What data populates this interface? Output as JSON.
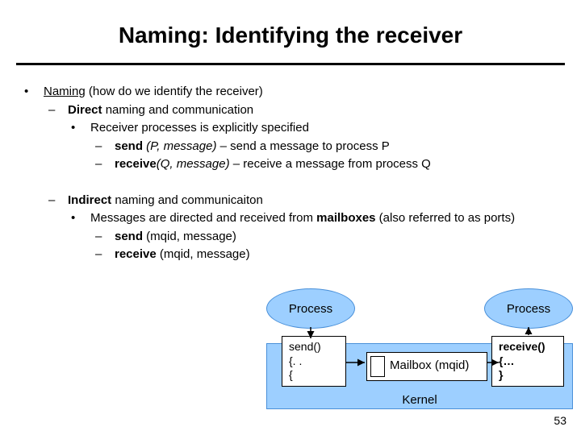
{
  "title": "Naming: Identifying the receiver",
  "l1_bullet": "•",
  "l1_topic": "Naming",
  "l1_rest": "  (how do we identify the receiver)",
  "dash": "–",
  "dot": "•",
  "direct_b": "Direct",
  "direct_rest": " naming and communication",
  "direct_sub": "Receiver processes is explicitly specified",
  "send_b": "send",
  "send_args": " (P, message)",
  "send_rest": " – send a message to process P",
  "recv_b": "receive",
  "recv_args": "(Q, message)",
  "recv_rest": " – receive a message from process Q",
  "indirect_b": "Indirect",
  "indirect_rest": " naming and communicaiton",
  "indirect_sub_a": "Messages are directed and received from ",
  "indirect_sub_b": "mailboxes",
  "indirect_sub_c": " (also referred to as ports)",
  "isend_b": "send",
  "isend_rest": " (mqid, message)",
  "irecv_b": "receive",
  "irecv_rest": " (mqid, message)",
  "proc_label": "Process",
  "kernel_label": "Kernel",
  "mailbox_label": "Mailbox (mqid)",
  "code_send_l1": "send()",
  "code_send_l2": "{. .",
  "code_send_l3": "{",
  "code_recv_l1": "receive()",
  "code_recv_l2": "{…",
  "code_recv_l3": "}",
  "page": "53"
}
